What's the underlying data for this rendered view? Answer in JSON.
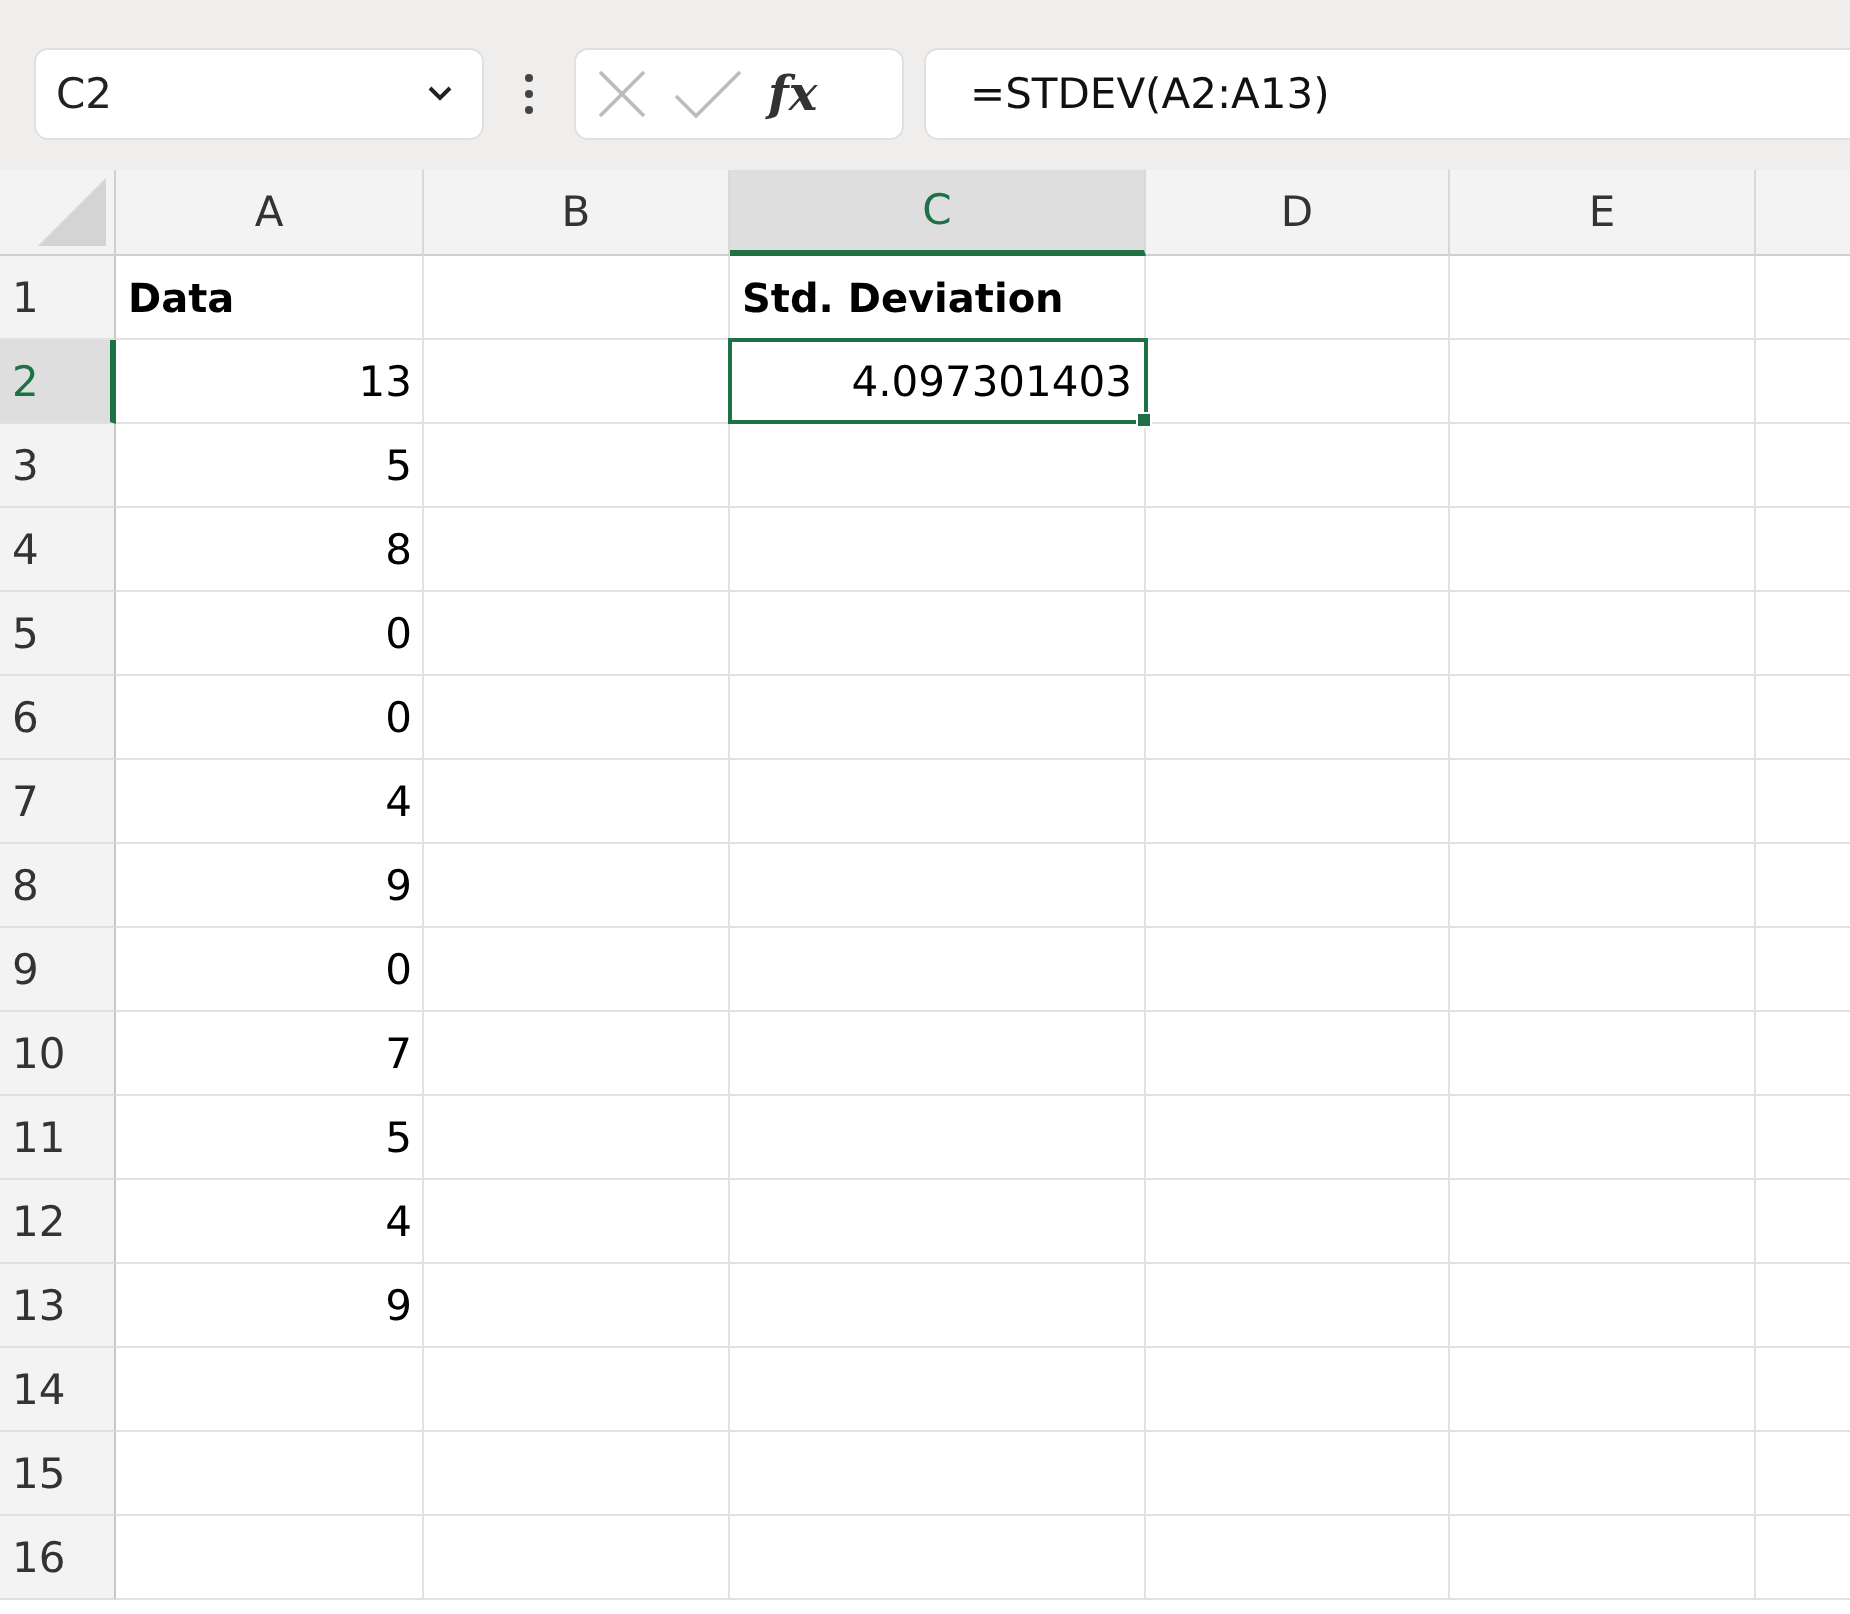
{
  "name_box": "C2",
  "fx_label": "fx",
  "formula": "=STDEV(A2:A13)",
  "columns": [
    {
      "label": "A",
      "selected": false
    },
    {
      "label": "B",
      "selected": false
    },
    {
      "label": "C",
      "selected": true
    },
    {
      "label": "D",
      "selected": false
    },
    {
      "label": "E",
      "selected": false
    }
  ],
  "rows": [
    {
      "label": "1",
      "selected": false,
      "kind": "header",
      "data": "Data",
      "result": "Std. Deviation"
    },
    {
      "label": "2",
      "selected": true,
      "kind": "value",
      "data": "13",
      "result": "4.097301403"
    },
    {
      "label": "3",
      "selected": false,
      "kind": "value",
      "data": "5"
    },
    {
      "label": "4",
      "selected": false,
      "kind": "value",
      "data": "8"
    },
    {
      "label": "5",
      "selected": false,
      "kind": "value",
      "data": "0"
    },
    {
      "label": "6",
      "selected": false,
      "kind": "value",
      "data": "0"
    },
    {
      "label": "7",
      "selected": false,
      "kind": "value",
      "data": "4"
    },
    {
      "label": "8",
      "selected": false,
      "kind": "value",
      "data": "9"
    },
    {
      "label": "9",
      "selected": false,
      "kind": "value",
      "data": "0"
    },
    {
      "label": "10",
      "selected": false,
      "kind": "value",
      "data": "7"
    },
    {
      "label": "11",
      "selected": false,
      "kind": "value",
      "data": "5"
    },
    {
      "label": "12",
      "selected": false,
      "kind": "value",
      "data": "4"
    },
    {
      "label": "13",
      "selected": false,
      "kind": "value",
      "data": "9"
    },
    {
      "label": "14",
      "selected": false
    },
    {
      "label": "15",
      "selected": false
    },
    {
      "label": "16",
      "selected": false
    }
  ]
}
